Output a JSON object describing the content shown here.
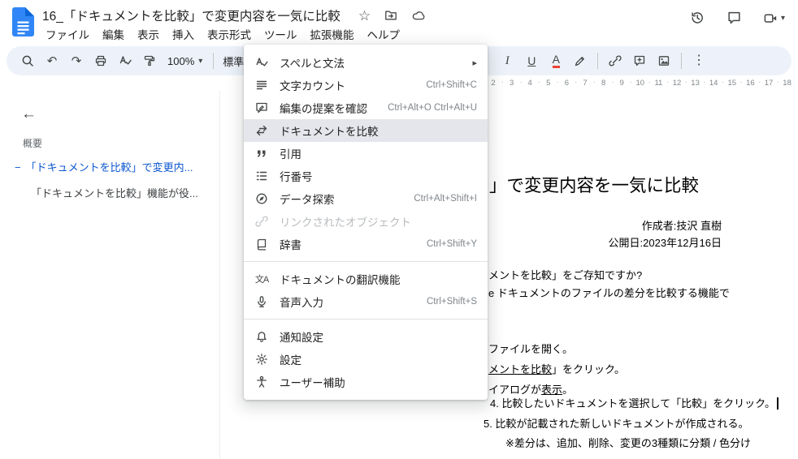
{
  "icons": {
    "star": "☆",
    "chevron_down": "▾",
    "submenu_arrow": "▸",
    "more_vertical": "⋮",
    "back_arrow": "←",
    "undo": "↶",
    "redo": "↷",
    "italic": "I",
    "underline": "U",
    "text_color": "A",
    "spellcheck": "A✓",
    "translate": "文A"
  },
  "header": {
    "doc_title": "16_「ドキュメントを比較」で変更内容を一気に比較",
    "menus": [
      {
        "label": "ファイル"
      },
      {
        "label": "編集"
      },
      {
        "label": "表示"
      },
      {
        "label": "挿入"
      },
      {
        "label": "表示形式"
      },
      {
        "label": "ツール"
      },
      {
        "label": "拡張機能"
      },
      {
        "label": "ヘルプ"
      }
    ]
  },
  "toolbar": {
    "zoom": "100%",
    "style": "標準"
  },
  "tools_menu": {
    "items": [
      {
        "label": "スペルと文法",
        "submenu": true
      },
      {
        "label": "文字カウント",
        "shortcut": "Ctrl+Shift+C"
      },
      {
        "label": "編集の提案を確認",
        "shortcut": "Ctrl+Alt+O Ctrl+Alt+U"
      },
      {
        "label": "ドキュメントを比較",
        "highlighted": true
      },
      {
        "label": "引用"
      },
      {
        "label": "行番号"
      },
      {
        "label": "データ探索",
        "shortcut": "Ctrl+Alt+Shift+I"
      },
      {
        "label": "リンクされたオブジェクト",
        "disabled": true
      },
      {
        "label": "辞書",
        "shortcut": "Ctrl+Shift+Y"
      },
      {
        "label": "ドキュメントの翻訳機能"
      },
      {
        "label": "音声入力",
        "shortcut": "Ctrl+Shift+S"
      },
      {
        "label": "通知設定"
      },
      {
        "label": "設定"
      },
      {
        "label": "ユーザー補助"
      }
    ]
  },
  "outline": {
    "heading": "概要",
    "items": [
      {
        "prefix": "−",
        "label": "「ドキュメントを比較」で変更内..."
      },
      {
        "prefix": "",
        "label": "「ドキュメントを比較」機能が役..."
      }
    ]
  },
  "ruler": {
    "ticks": [
      "2",
      "3",
      "4",
      "5",
      "6",
      "7",
      "8",
      "9",
      "10",
      "11",
      "12",
      "13",
      "14",
      "15",
      "16",
      "17",
      "18"
    ]
  },
  "document": {
    "title_fragment": "」で変更内容を一気に比較",
    "author": "作成者:技沢 直樹",
    "date": "公開日:2023年12月16日",
    "f1": "メントを比較」をご存知ですか?",
    "f2": "e ドキュメントのファイルの差分を比較する機能で",
    "f3": "ファイルを開く。",
    "f4a": "メントを比較",
    "f4b": "」をクリック。",
    "f5a": "イアログが",
    "f5b": "表示",
    "f5c": "。",
    "f6": "4. 比較したいドキュメントを選択して「比較」をクリック。",
    "f7": "5. 比較が記載された新しいドキュメントが作成される。",
    "f8": "※差分は、追加、削除、変更の3種類に分類 / 色分け"
  }
}
